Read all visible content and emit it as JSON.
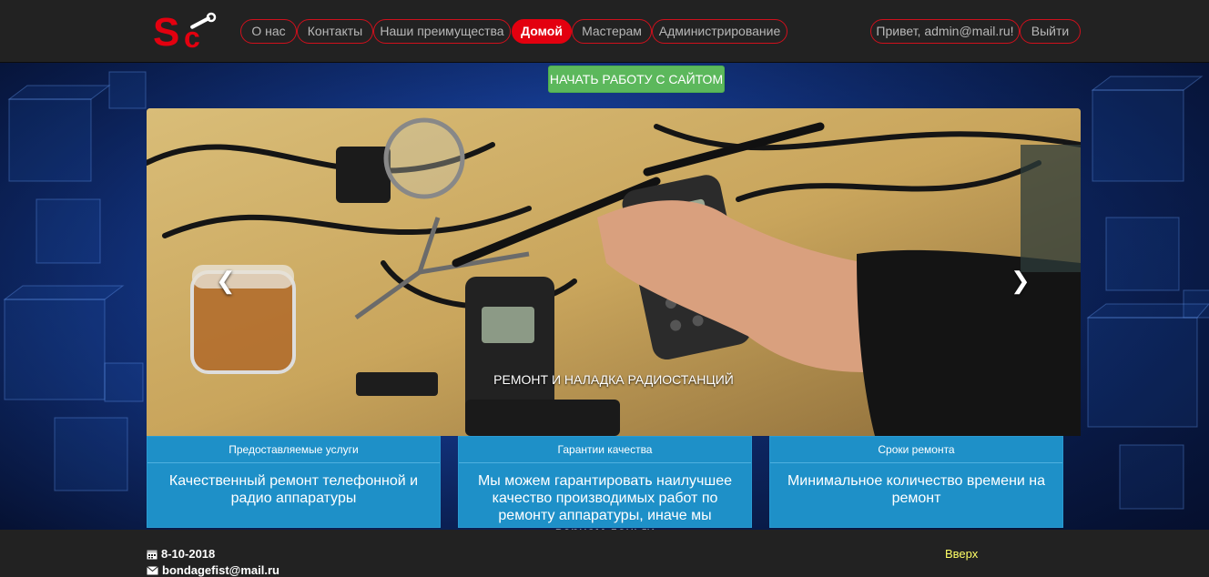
{
  "header": {
    "logo_text": "Sc",
    "nav": [
      {
        "label": "О нас"
      },
      {
        "label": "Контакты"
      },
      {
        "label": "Наши преимущества"
      },
      {
        "label": "Домой"
      },
      {
        "label": "Мастерам"
      },
      {
        "label": "Администрирование"
      }
    ],
    "active_nav": "Домой",
    "greeting": "Привет, admin@mail.ru!",
    "logout": "Выйти"
  },
  "hero": {
    "start_button": "НАЧАТЬ РАБОТУ С САЙТОМ",
    "slide_caption": "РЕМОНТ И НАЛАДКА РАДИОСТАНЦИЙ"
  },
  "features": [
    {
      "title": "Предоставляемые услуги",
      "text": "Качественный ремонт телефонной и радио аппаратуры"
    },
    {
      "title": "Гарантии качества",
      "text": "Мы можем гарантировать наилучшее качество производимых работ по ремонту аппаратуры, иначе мы вернем деньги"
    },
    {
      "title": "Сроки ремонта",
      "text": "Минимальное количество времени на ремонт"
    }
  ],
  "footer": {
    "date": "8-10-2018",
    "email": "bondagefist@mail.ru",
    "up_link": "Вверх"
  },
  "colors": {
    "accent_red": "#e3000f",
    "start_green": "#5cb85c",
    "feature_blue": "#1e90c8",
    "up_yellow": "#ffff66"
  },
  "icons": {
    "prev": "chevron-left-icon",
    "next": "chevron-right-icon",
    "date": "calendar-icon",
    "email": "envelope-icon"
  }
}
